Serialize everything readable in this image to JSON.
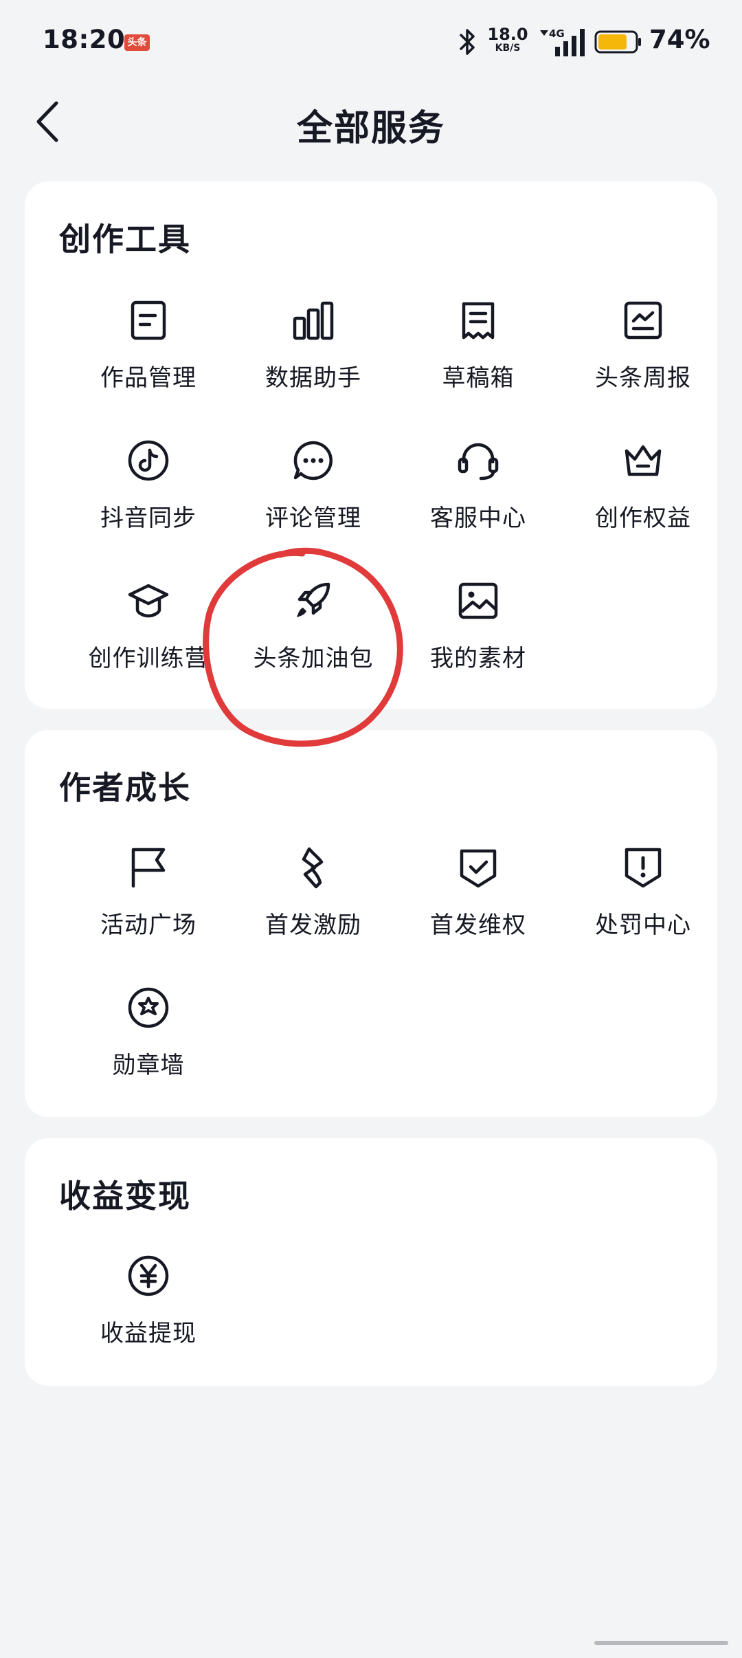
{
  "status_bar": {
    "time": "18:20",
    "app_badge": "头条",
    "net_speed": "18.0",
    "net_unit": "KB/S",
    "network": "4G",
    "battery": "74%",
    "battery_color": "#f5b70a"
  },
  "header": {
    "title": "全部服务",
    "back_icon": "chevron-left-icon"
  },
  "sections": [
    {
      "title": "创作工具",
      "items": [
        {
          "label": "作品管理",
          "icon": "document-icon"
        },
        {
          "label": "数据助手",
          "icon": "bar-chart-icon"
        },
        {
          "label": "草稿箱",
          "icon": "draft-icon"
        },
        {
          "label": "头条周报",
          "icon": "report-chart-icon"
        },
        {
          "label": "抖音同步",
          "icon": "douyin-icon"
        },
        {
          "label": "评论管理",
          "icon": "comment-icon"
        },
        {
          "label": "客服中心",
          "icon": "headset-icon"
        },
        {
          "label": "创作权益",
          "icon": "crown-icon"
        },
        {
          "label": "创作训练营",
          "icon": "graduation-cap-icon"
        },
        {
          "label": "头条加油包",
          "icon": "rocket-icon"
        },
        {
          "label": "我的素材",
          "icon": "image-icon"
        }
      ]
    },
    {
      "title": "作者成长",
      "items": [
        {
          "label": "活动广场",
          "icon": "flag-icon"
        },
        {
          "label": "首发激励",
          "icon": "lightning-icon"
        },
        {
          "label": "首发维权",
          "icon": "shield-check-icon"
        },
        {
          "label": "处罚中心",
          "icon": "shield-alert-icon"
        },
        {
          "label": "勋章墙",
          "icon": "medal-icon"
        }
      ]
    },
    {
      "title": "收益变现",
      "items": [
        {
          "label": "收益提现",
          "icon": "yuan-icon"
        }
      ]
    }
  ],
  "annotation_color": "#e03a3a"
}
